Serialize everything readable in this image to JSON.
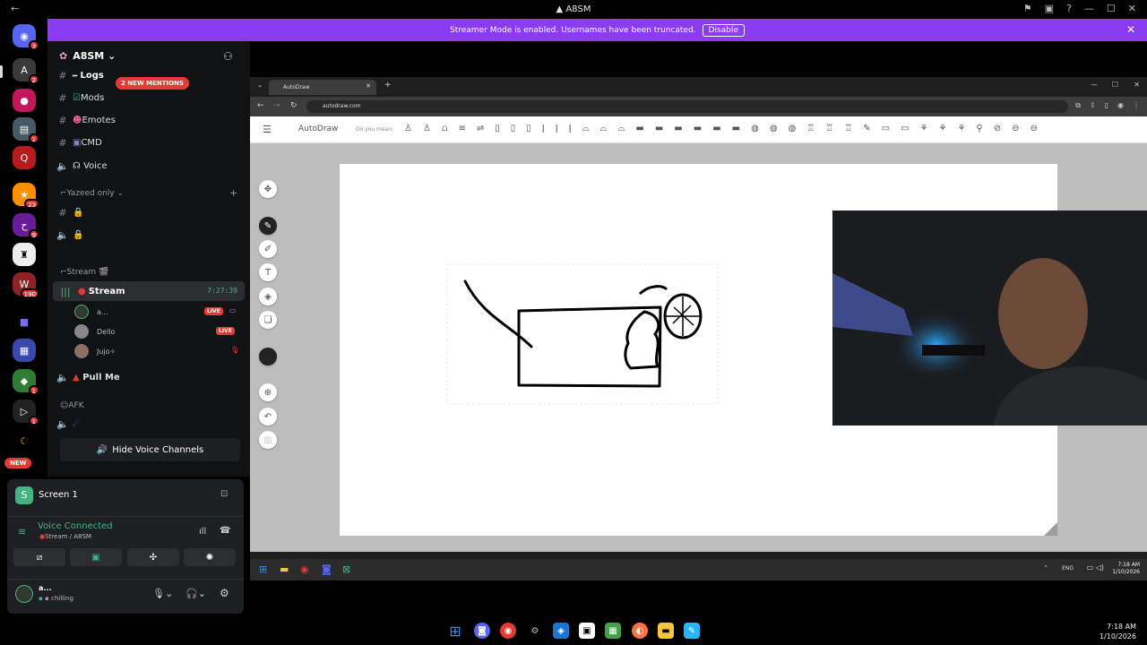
{
  "window": {
    "title": "A8SM"
  },
  "banner": {
    "text": "Streamer Mode is enabled. Usernames have been truncated.",
    "disable_label": "Disable"
  },
  "server": {
    "name": "A8SM"
  },
  "mentions_badge": "2 NEW MENTIONS",
  "channels": [
    {
      "label": "Logs"
    },
    {
      "label": "Mods"
    },
    {
      "label": "Emotes"
    },
    {
      "label": "CMD"
    },
    {
      "label": "Voice"
    }
  ],
  "category_yazeed": "Yazeed only",
  "category_stream": "Stream",
  "stream_channel": {
    "label": "Stream",
    "timer": "7:27:39"
  },
  "voice_users": [
    {
      "name": "a...",
      "live": "LIVE"
    },
    {
      "name": "Dello",
      "live": "LIVE"
    },
    {
      "name": "Jujo"
    }
  ],
  "pull_me": "Pull Me",
  "afk": "AFK",
  "hide_voice": "Hide Voice Channels",
  "screenshare": {
    "title": "Screen 1"
  },
  "voice_status": {
    "title": "Voice Connected",
    "sub": "Stream / A8SM"
  },
  "me": {
    "name": "a...",
    "status": "chilling"
  },
  "rail_badges": [
    "3",
    "2",
    "1",
    "23",
    "9",
    "190",
    "1",
    "1"
  ],
  "rail_new": "NEW",
  "browser": {
    "tab_title": "AutoDraw",
    "url": "autodraw.com"
  },
  "autodraw": {
    "brand": "AutoDraw",
    "do_you_mean": "Do you mean:"
  },
  "inner_clock": {
    "lang": "ENG",
    "time": "7:18 AM",
    "date": "1/10/2026"
  },
  "taskbar_clock": {
    "time": "7:18 AM",
    "date": "1/10/2026"
  }
}
